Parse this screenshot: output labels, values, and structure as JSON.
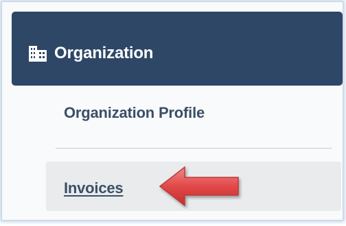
{
  "sidebar": {
    "header": {
      "title": "Organization",
      "icon": "building-icon"
    },
    "items": [
      {
        "label": "Organization Profile",
        "active": false
      },
      {
        "label": "Invoices",
        "active": true
      }
    ]
  },
  "annotation": {
    "icon": "left-arrow-icon",
    "color": "#e04545",
    "points_to": "Invoices"
  },
  "colors": {
    "header_bg": "#2e4766",
    "header_text": "#ffffff",
    "item_text": "#3b4f66",
    "active_bg": "#e9ebec"
  }
}
